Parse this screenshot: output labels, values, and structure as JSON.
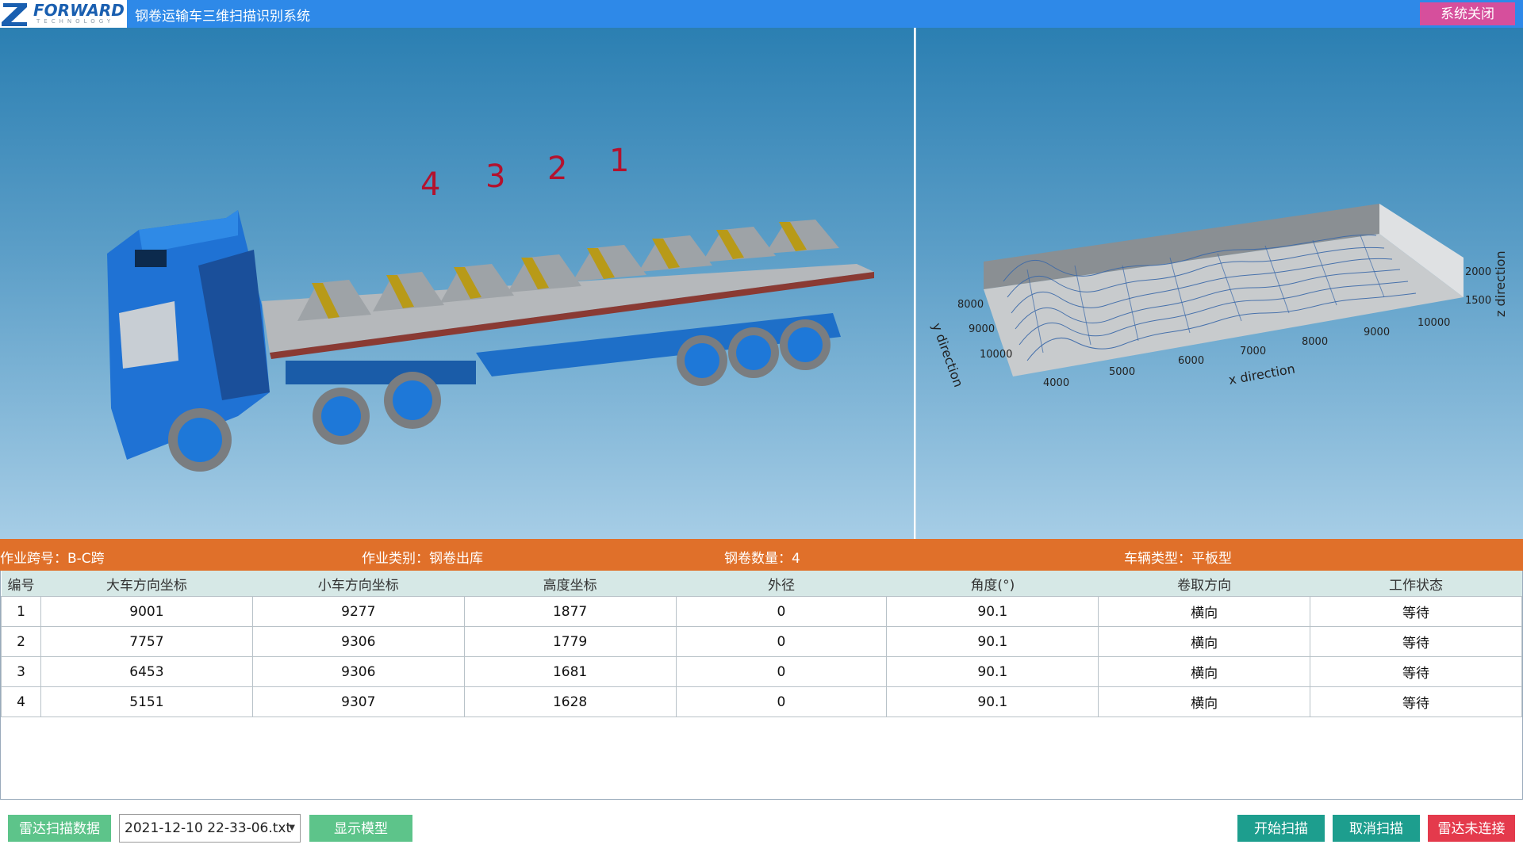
{
  "header": {
    "logo_text": "FORWARD",
    "logo_sub": "TECHNOLOGY",
    "app_title": "钢卷运输车三维扫描识别系统",
    "close_label": "系统关闭"
  },
  "model_view": {
    "coil_numbers": [
      "4",
      "3",
      "2",
      "1"
    ]
  },
  "plot_view": {
    "x_axis_label": "x direction",
    "y_axis_label": "y direction",
    "z_axis_label": "z direction",
    "x_ticks": [
      "4000",
      "5000",
      "6000",
      "7000",
      "8000",
      "9000",
      "10000"
    ],
    "y_ticks": [
      "8000",
      "9000",
      "10000"
    ],
    "z_ticks": [
      "2000",
      "1500"
    ]
  },
  "info_bar": {
    "span": "作业跨号：B-C跨",
    "job_type": "作业类别：钢卷出库",
    "coil_count": "钢卷数量：4",
    "vehicle_type": "车辆类型：平板型"
  },
  "table": {
    "headers": [
      "编号",
      "大车方向坐标",
      "小车方向坐标",
      "高度坐标",
      "外径",
      "角度(°)",
      "卷取方向",
      "工作状态"
    ],
    "rows": [
      [
        "1",
        "9001",
        "9277",
        "1877",
        "0",
        "90.1",
        "横向",
        "等待"
      ],
      [
        "2",
        "7757",
        "9306",
        "1779",
        "0",
        "90.1",
        "横向",
        "等待"
      ],
      [
        "3",
        "6453",
        "9306",
        "1681",
        "0",
        "90.1",
        "横向",
        "等待"
      ],
      [
        "4",
        "5151",
        "9307",
        "1628",
        "0",
        "90.1",
        "横向",
        "等待"
      ]
    ]
  },
  "bottom_bar": {
    "radar_data_label": "雷达扫描数据",
    "file_selected": "2021-12-10 22-33-06.txt",
    "show_model_label": "显示模型",
    "start_scan_label": "开始扫描",
    "cancel_scan_label": "取消扫描",
    "radar_status_label": "雷达未连接"
  },
  "colors": {
    "title_bar": "#2e89e8",
    "close_button": "#d64f9c",
    "info_bar": "#e0702a",
    "green_button": "#5dc48a",
    "teal_button": "#1d9e8e",
    "red_button": "#e43a4c"
  }
}
